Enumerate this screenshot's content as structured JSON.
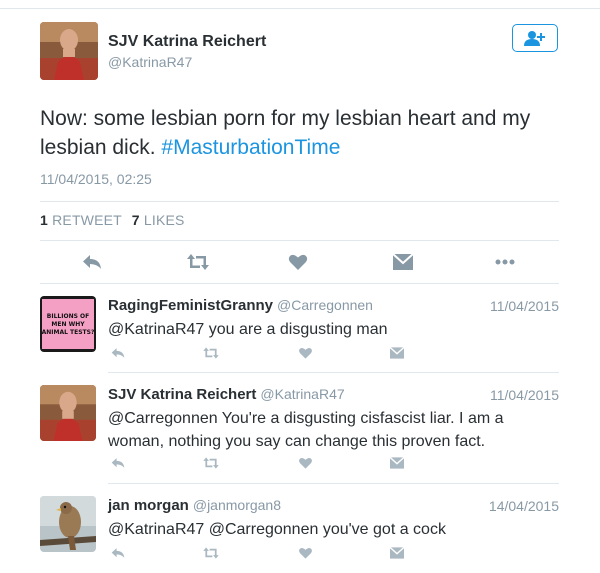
{
  "main_tweet": {
    "author_name": "SJV Katrina Reichert",
    "author_handle": "@KatrinaR47",
    "text": "Now: some lesbian porn for my lesbian heart and my lesbian dick. ",
    "hashtag": "#MasturbationTime",
    "timestamp": "11/04/2015, 02:25",
    "retweet_count": "1",
    "retweet_label": "RETWEET",
    "like_count": "7",
    "like_label": "LIKES",
    "follow_icon": "follow-user-icon"
  },
  "replies": [
    {
      "author_name": "RagingFeministGranny",
      "author_handle": "@Carregonnen",
      "date": "11/04/2015",
      "text": "@KatrinaR47 you are a disgusting man",
      "avatar_text": "BILLIONS OF MEN WHY ANIMAL TESTS?"
    },
    {
      "author_name": "SJV Katrina Reichert",
      "author_handle": "@KatrinaR47",
      "date": "11/04/2015",
      "text": "@Carregonnen You're a disgusting cisfascist liar. I am a woman, nothing you say can change this proven fact."
    },
    {
      "author_name": "jan morgan",
      "author_handle": "@janmorgan8",
      "date": "14/04/2015",
      "text": "@KatrinaR47 @Carregonnen you've got a cock"
    }
  ],
  "colors": {
    "link": "#1b95e0",
    "muted": "#8899a6",
    "text": "#292f33",
    "divider": "#e1e8ed",
    "icon": "#aab8c2"
  }
}
